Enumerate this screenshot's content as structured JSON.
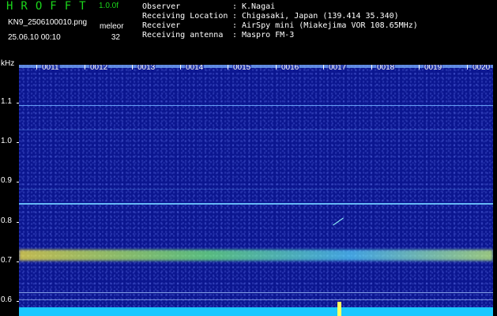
{
  "app": {
    "title": "HROFFT",
    "version": "1.0.0f"
  },
  "file": {
    "name": "KN9_2506100010.png",
    "timestamp": "25.06.10 00:10"
  },
  "mode": {
    "label": "meleor",
    "value": "32"
  },
  "info": [
    {
      "label": "Observer",
      "value": "K.Nagai"
    },
    {
      "label": "Receiving Location",
      "value": "Chigasaki, Japan (139.414 35.340)"
    },
    {
      "label": "Receiver",
      "value": "AirSpy mini (Miakejima VOR 108.65MHz)"
    },
    {
      "label": "Receiving antenna",
      "value": "Maspro FM-3"
    }
  ],
  "axis": {
    "unit": "kHz",
    "ticks": [
      "1.1",
      "1.0",
      "0.9",
      "0.8",
      "0.7",
      "0.6"
    ],
    "minutes": [
      "0011",
      "0012",
      "0013",
      "0014",
      "0015",
      "0016",
      "0017",
      "0018",
      "0019",
      "0020"
    ]
  },
  "colors": {
    "background": "#0b1690",
    "title": "#1bd61b",
    "strip": "#19c8ff"
  }
}
